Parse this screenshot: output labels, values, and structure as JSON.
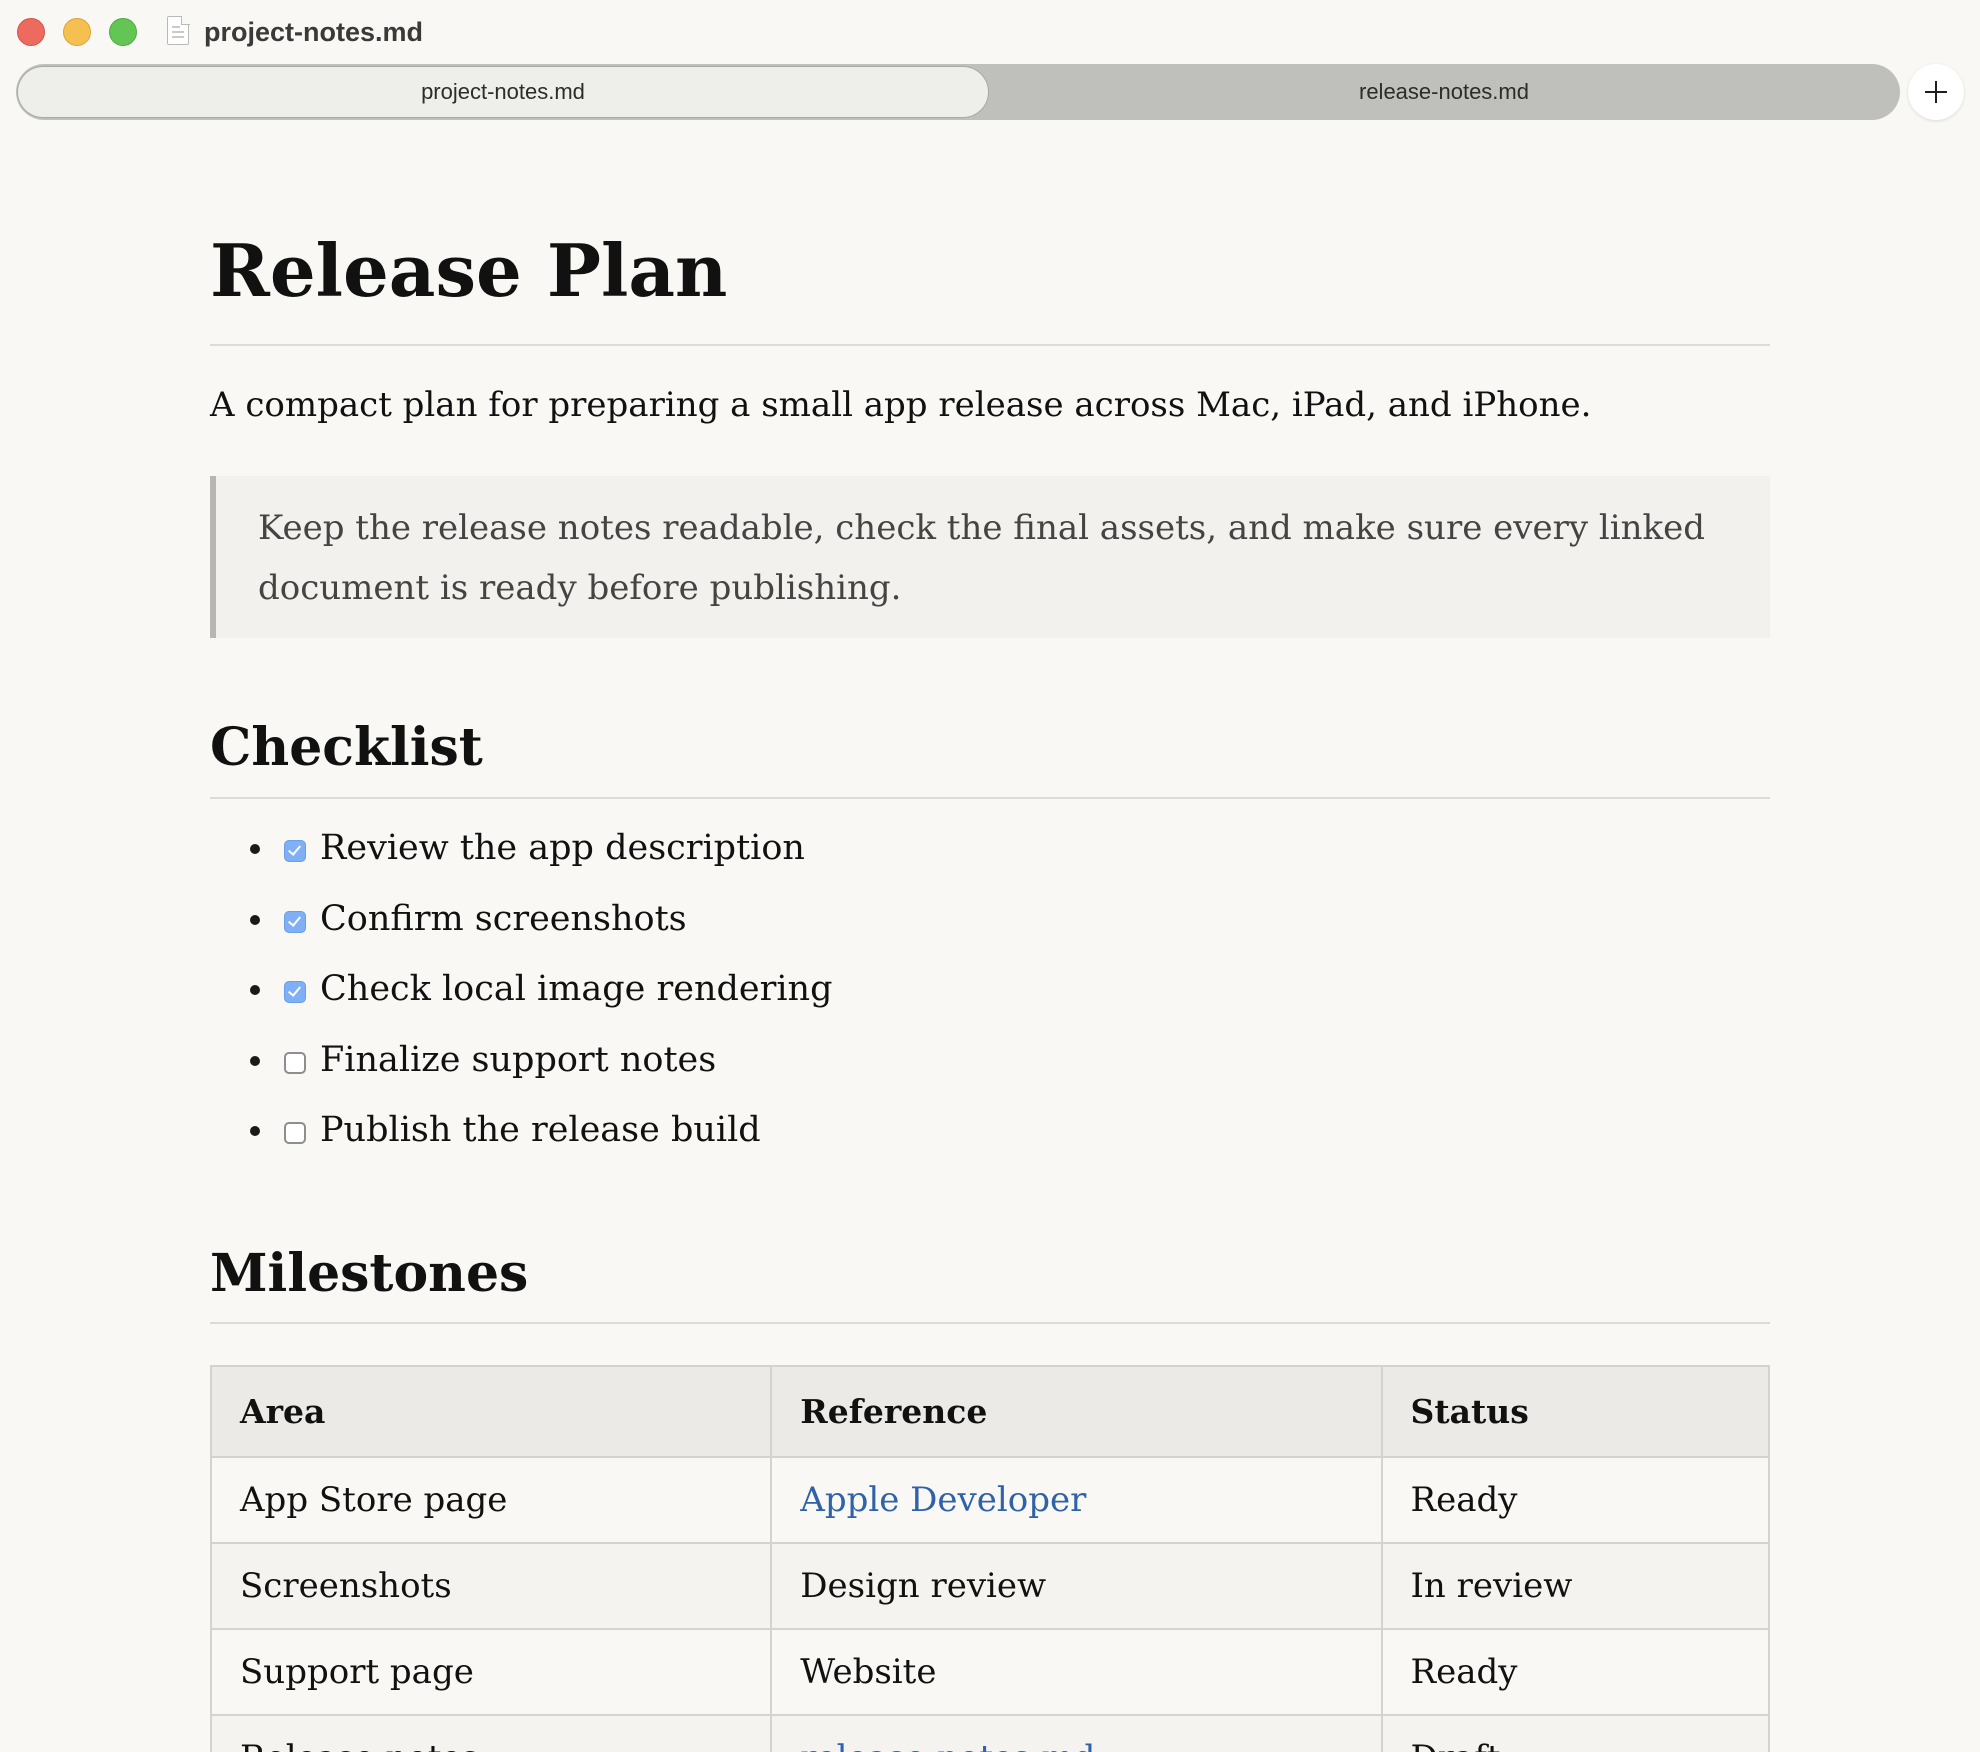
{
  "window": {
    "title": "project-notes.md"
  },
  "tabs": [
    {
      "label": "project-notes.md",
      "active": true
    },
    {
      "label": "release-notes.md",
      "active": false
    }
  ],
  "new_tab_icon": "plus-icon",
  "document": {
    "title": "Release Plan",
    "intro": "A compact plan for preparing a small app release across Mac, iPad, and iPhone.",
    "quote": "Keep the release notes readable, check the final assets, and make sure every linked document is ready before publishing.",
    "checklist_heading": "Checklist",
    "checklist": [
      {
        "label": "Review the app description",
        "checked": true
      },
      {
        "label": "Confirm screenshots",
        "checked": true
      },
      {
        "label": "Check local image rendering",
        "checked": true
      },
      {
        "label": "Finalize support notes",
        "checked": false
      },
      {
        "label": "Publish the release build",
        "checked": false
      }
    ],
    "milestones_heading": "Milestones",
    "table": {
      "headers": [
        "Area",
        "Reference",
        "Status"
      ],
      "rows": [
        {
          "area": "App Store page",
          "reference": "Apple Developer",
          "reference_is_link": true,
          "status": "Ready"
        },
        {
          "area": "Screenshots",
          "reference": "Design review",
          "reference_is_link": false,
          "status": "In review"
        },
        {
          "area": "Support page",
          "reference": "Website",
          "reference_is_link": false,
          "status": "Ready"
        },
        {
          "area": "Release notes",
          "reference": "release-notes.md",
          "reference_is_link": true,
          "status": "Draft"
        }
      ]
    }
  },
  "colors": {
    "background": "#f9f8f5",
    "link": "#2f62a6",
    "checkbox_checked": "#7fb0f5",
    "traffic_close": "#ed6a5e",
    "traffic_minimize": "#f5c04f",
    "traffic_zoom": "#62c554"
  }
}
